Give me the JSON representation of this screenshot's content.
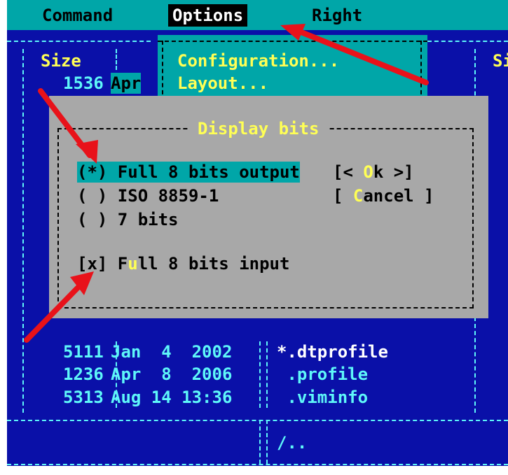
{
  "menu": {
    "command": "Command",
    "options": "Options",
    "right": "Right"
  },
  "panel_header": {
    "size": "Size",
    "right_size": "Si",
    "row1_size": "1536",
    "row1_month": "Apr"
  },
  "options_menu": {
    "configuration": "Configuration...",
    "layout": "Layout..."
  },
  "dialog": {
    "title": "Display bits",
    "options": [
      "(*) Full 8 bits output",
      "( ) ISO 8859-1",
      "( ) 7 bits"
    ],
    "ok_pre": "[< ",
    "ok_hot": "O",
    "ok_post": "k >]",
    "cancel_pre": "[ ",
    "cancel_hot": "C",
    "cancel_post": "ancel ]",
    "input_pre": "[x] F",
    "input_hot": "u",
    "input_post": "ll 8 bits input"
  },
  "file_rows": [
    {
      "size": "5111",
      "date": "Jan  4  2002",
      "name": "*.dtprofile"
    },
    {
      "size": "1236",
      "date": "Apr  8  2006",
      "name": " .profile"
    },
    {
      "size": "5313",
      "date": "Aug 14 13:36",
      "name": " .viminfo"
    }
  ],
  "bottom": {
    "path": "/.."
  },
  "colors": {
    "panel_bg": "#0a10a8",
    "menu_bg": "#00a6a8",
    "dialog_bg": "#a8a8a8",
    "hotkey": "#ffff55",
    "arrow": "#e8121a"
  }
}
